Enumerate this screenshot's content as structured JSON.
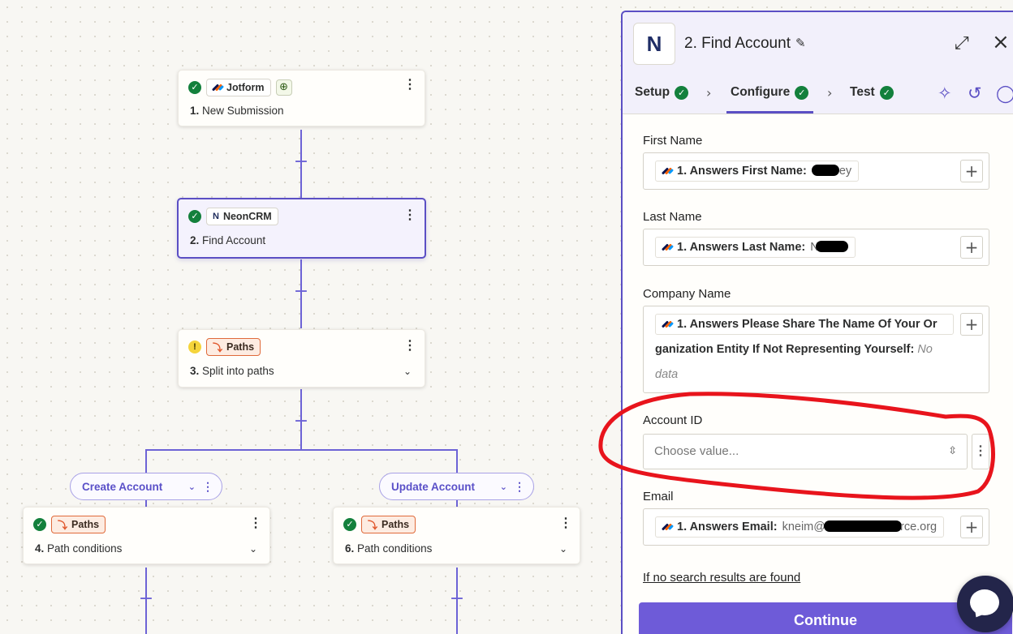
{
  "canvas": {
    "steps": [
      {
        "app": "Jotform",
        "number": "1.",
        "name": "New Submission"
      },
      {
        "app": "NeonCRM",
        "number": "2.",
        "name": "Find Account"
      },
      {
        "app": "Paths",
        "number": "3.",
        "name": "Split into paths"
      },
      {
        "app": "Paths",
        "number": "4.",
        "name": "Path conditions"
      },
      {
        "app": "Paths",
        "number": "6.",
        "name": "Path conditions"
      }
    ],
    "branches": [
      {
        "label": "Create Account"
      },
      {
        "label": "Update Account"
      }
    ]
  },
  "panel": {
    "title": "2. Find Account",
    "tabs": [
      {
        "label": "Setup"
      },
      {
        "label": "Configure"
      },
      {
        "label": "Test"
      }
    ],
    "fields": {
      "first_name": {
        "label": "First Name",
        "pill_label": "1. Answers First Name:",
        "visible_value": "ey"
      },
      "last_name": {
        "label": "Last Name",
        "pill_label": "1. Answers Last Name:",
        "visible_value": "N"
      },
      "company_name": {
        "label": "Company Name",
        "line1": "1. Answers Please Share The Name Of Your Or",
        "line2": "ganization Entity If Not Representing Yourself:",
        "no_data_1": "No",
        "no_data_2": "data"
      },
      "account_id": {
        "label": "Account ID",
        "placeholder": "Choose value..."
      },
      "email": {
        "label": "Email",
        "pill_label": "1. Answers Email:",
        "visible_value_start": "kneim@",
        "visible_value_end": "rce.org"
      }
    },
    "no_results_link": "If no search results are found",
    "continue_label": "Continue"
  },
  "colors": {
    "accent": "#5b4fc4",
    "success": "#13803c",
    "warning": "#f5d43a",
    "paths": "#e0552a",
    "annotation": "#e8141c"
  }
}
